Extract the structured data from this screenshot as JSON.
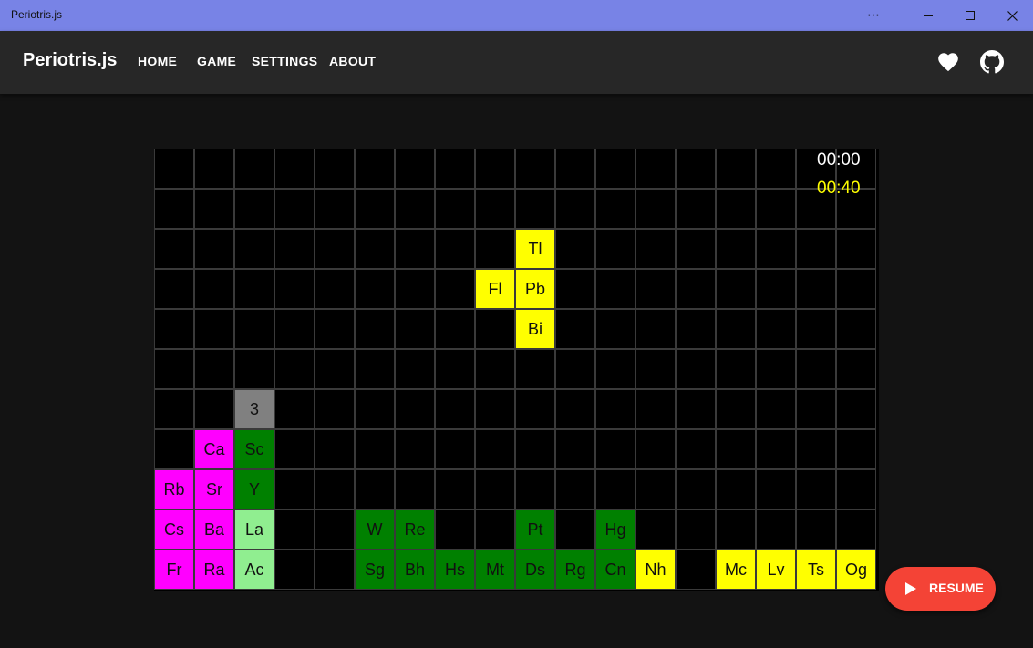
{
  "window": {
    "title": "Periotris.js"
  },
  "header": {
    "brand": "Periotris.js",
    "nav": [
      {
        "label": "HOME"
      },
      {
        "label": "GAME"
      },
      {
        "label": "SETTINGS"
      },
      {
        "label": "ABOUT"
      }
    ],
    "icons": [
      "heart-icon",
      "github-icon"
    ]
  },
  "timers": {
    "elapsed": "00:00",
    "limit": "00:40"
  },
  "colors": {
    "alkali": "#ff00ff",
    "lanthanide": "#90ee90",
    "transition": "#008000",
    "post_transition": "#ffff00",
    "unknown": "#808080",
    "accent": "#f44336"
  },
  "grid": {
    "columns": 18,
    "rows": 11
  },
  "tiles": [
    {
      "symbol": "Tl",
      "row": 2,
      "col": 9,
      "group": "post_transition"
    },
    {
      "symbol": "Fl",
      "row": 3,
      "col": 8,
      "group": "post_transition"
    },
    {
      "symbol": "Pb",
      "row": 3,
      "col": 9,
      "group": "post_transition"
    },
    {
      "symbol": "Bi",
      "row": 4,
      "col": 9,
      "group": "post_transition"
    },
    {
      "symbol": "3",
      "row": 6,
      "col": 2,
      "group": "unknown"
    },
    {
      "symbol": "Ca",
      "row": 7,
      "col": 1,
      "group": "alkali"
    },
    {
      "symbol": "Sc",
      "row": 7,
      "col": 2,
      "group": "transition"
    },
    {
      "symbol": "Rb",
      "row": 8,
      "col": 0,
      "group": "alkali"
    },
    {
      "symbol": "Sr",
      "row": 8,
      "col": 1,
      "group": "alkali"
    },
    {
      "symbol": "Y",
      "row": 8,
      "col": 2,
      "group": "transition"
    },
    {
      "symbol": "Cs",
      "row": 9,
      "col": 0,
      "group": "alkali"
    },
    {
      "symbol": "Ba",
      "row": 9,
      "col": 1,
      "group": "alkali"
    },
    {
      "symbol": "La",
      "row": 9,
      "col": 2,
      "group": "lanthanide"
    },
    {
      "symbol": "W",
      "row": 9,
      "col": 5,
      "group": "transition"
    },
    {
      "symbol": "Re",
      "row": 9,
      "col": 6,
      "group": "transition"
    },
    {
      "symbol": "Pt",
      "row": 9,
      "col": 9,
      "group": "transition"
    },
    {
      "symbol": "Hg",
      "row": 9,
      "col": 11,
      "group": "transition"
    },
    {
      "symbol": "Fr",
      "row": 10,
      "col": 0,
      "group": "alkali"
    },
    {
      "symbol": "Ra",
      "row": 10,
      "col": 1,
      "group": "alkali"
    },
    {
      "symbol": "Ac",
      "row": 10,
      "col": 2,
      "group": "lanthanide"
    },
    {
      "symbol": "Sg",
      "row": 10,
      "col": 5,
      "group": "transition"
    },
    {
      "symbol": "Bh",
      "row": 10,
      "col": 6,
      "group": "transition"
    },
    {
      "symbol": "Hs",
      "row": 10,
      "col": 7,
      "group": "transition"
    },
    {
      "symbol": "Mt",
      "row": 10,
      "col": 8,
      "group": "transition"
    },
    {
      "symbol": "Ds",
      "row": 10,
      "col": 9,
      "group": "transition"
    },
    {
      "symbol": "Rg",
      "row": 10,
      "col": 10,
      "group": "transition"
    },
    {
      "symbol": "Cn",
      "row": 10,
      "col": 11,
      "group": "transition"
    },
    {
      "symbol": "Nh",
      "row": 10,
      "col": 12,
      "group": "post_transition"
    },
    {
      "symbol": "Mc",
      "row": 10,
      "col": 14,
      "group": "post_transition"
    },
    {
      "symbol": "Lv",
      "row": 10,
      "col": 15,
      "group": "post_transition"
    },
    {
      "symbol": "Ts",
      "row": 10,
      "col": 16,
      "group": "post_transition"
    },
    {
      "symbol": "Og",
      "row": 10,
      "col": 17,
      "group": "post_transition"
    }
  ],
  "actions": {
    "resume_label": "RESUME"
  }
}
